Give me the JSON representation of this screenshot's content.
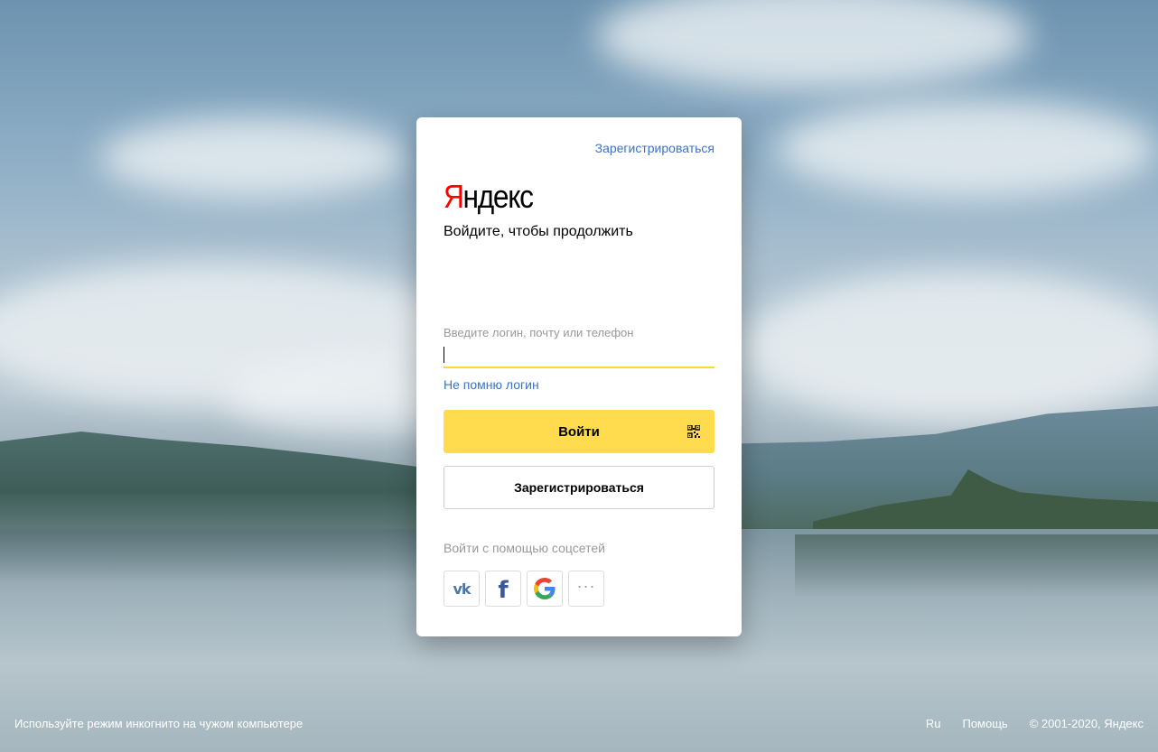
{
  "header": {
    "register_link": "Зарегистрироваться"
  },
  "logo": {
    "first_letter": "Я",
    "rest": "ндекс"
  },
  "subtitle": "Войдите, чтобы продолжить",
  "login_form": {
    "field_label": "Введите логин, почту или телефон",
    "field_value": "",
    "forgot_link": "Не помню логин",
    "login_button": "Войти",
    "register_button": "Зарегистрироваться"
  },
  "social": {
    "label": "Войти с помощью соцсетей",
    "providers": [
      "vk-icon",
      "facebook-icon",
      "google-icon",
      "more-icon"
    ],
    "vk_glyph": "vk",
    "fb_glyph": "f",
    "more_glyph": "···"
  },
  "footer": {
    "incognito_tip": "Используйте режим инкогнито на чужом компьютере",
    "language": "Ru",
    "help": "Помощь",
    "copyright": "© 2001-2020, Яндекс"
  },
  "colors": {
    "accent_yellow": "#ffdb4d",
    "link_blue": "#3a73c9",
    "logo_red": "#ff0000"
  }
}
